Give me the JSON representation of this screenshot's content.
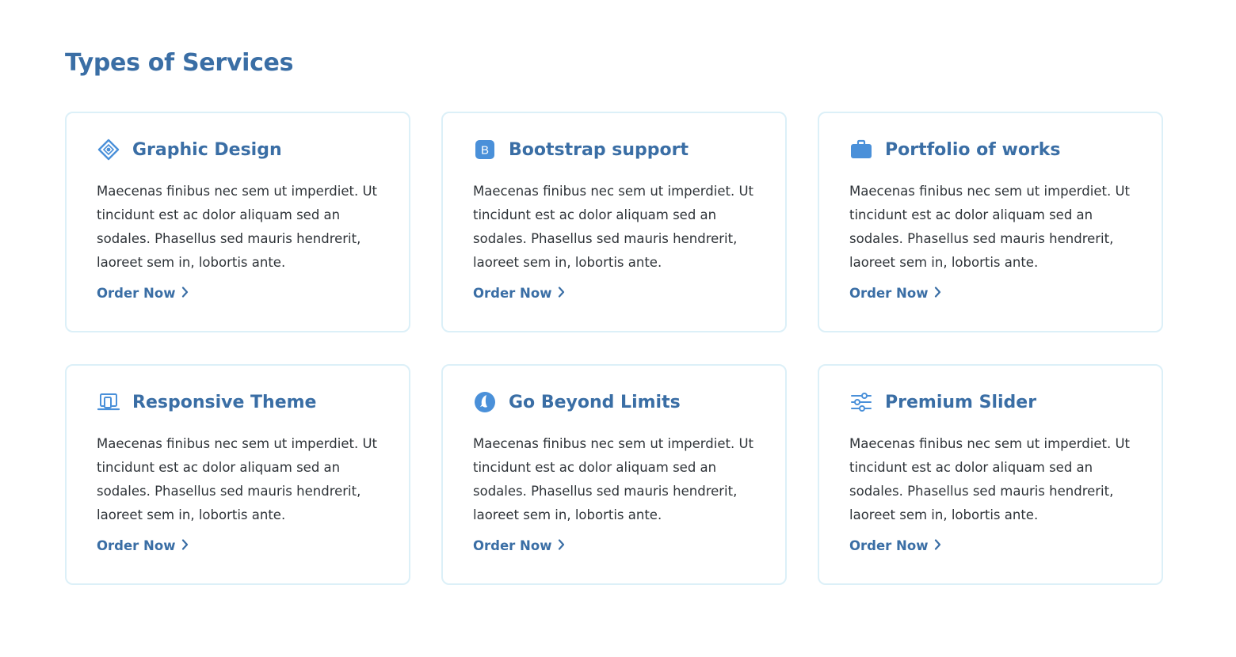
{
  "section": {
    "title": "Types of Services"
  },
  "colors": {
    "accent": "#3a6ea5",
    "icon": "#4a90d9",
    "card_border": "#dcf0f8",
    "body_text": "#2e3338"
  },
  "cards": [
    {
      "icon": "diamond-target-icon",
      "title": "Graphic Design",
      "text": "Maecenas finibus nec sem ut imperdiet. Ut tincidunt est ac dolor aliquam sed an sodales. Phasellus sed mauris hendrerit, laoreet sem in, lobortis ante.",
      "link": "Order Now"
    },
    {
      "icon": "bootstrap-icon",
      "title": "Bootstrap support",
      "text": "Maecenas finibus nec sem ut imperdiet. Ut tincidunt est ac dolor aliquam sed an sodales. Phasellus sed mauris hendrerit, laoreet sem in, lobortis ante.",
      "link": "Order Now"
    },
    {
      "icon": "briefcase-icon",
      "title": "Portfolio of works",
      "text": "Maecenas finibus nec sem ut imperdiet. Ut tincidunt est ac dolor aliquam sed an sodales. Phasellus sed mauris hendrerit, laoreet sem in, lobortis ante.",
      "link": "Order Now"
    },
    {
      "icon": "laptop-phone-icon",
      "title": "Responsive Theme",
      "text": "Maecenas finibus nec sem ut imperdiet. Ut tincidunt est ac dolor aliquam sed an sodales. Phasellus sed mauris hendrerit, laoreet sem in, lobortis ante.",
      "link": "Order Now"
    },
    {
      "icon": "rocket-circle-icon",
      "title": "Go Beyond Limits",
      "text": "Maecenas finibus nec sem ut imperdiet. Ut tincidunt est ac dolor aliquam sed an sodales. Phasellus sed mauris hendrerit, laoreet sem in, lobortis ante.",
      "link": "Order Now"
    },
    {
      "icon": "sliders-icon",
      "title": "Premium Slider",
      "text": "Maecenas finibus nec sem ut imperdiet. Ut tincidunt est ac dolor aliquam sed an sodales. Phasellus sed mauris hendrerit, laoreet sem in, lobortis ante.",
      "link": "Order Now"
    }
  ]
}
